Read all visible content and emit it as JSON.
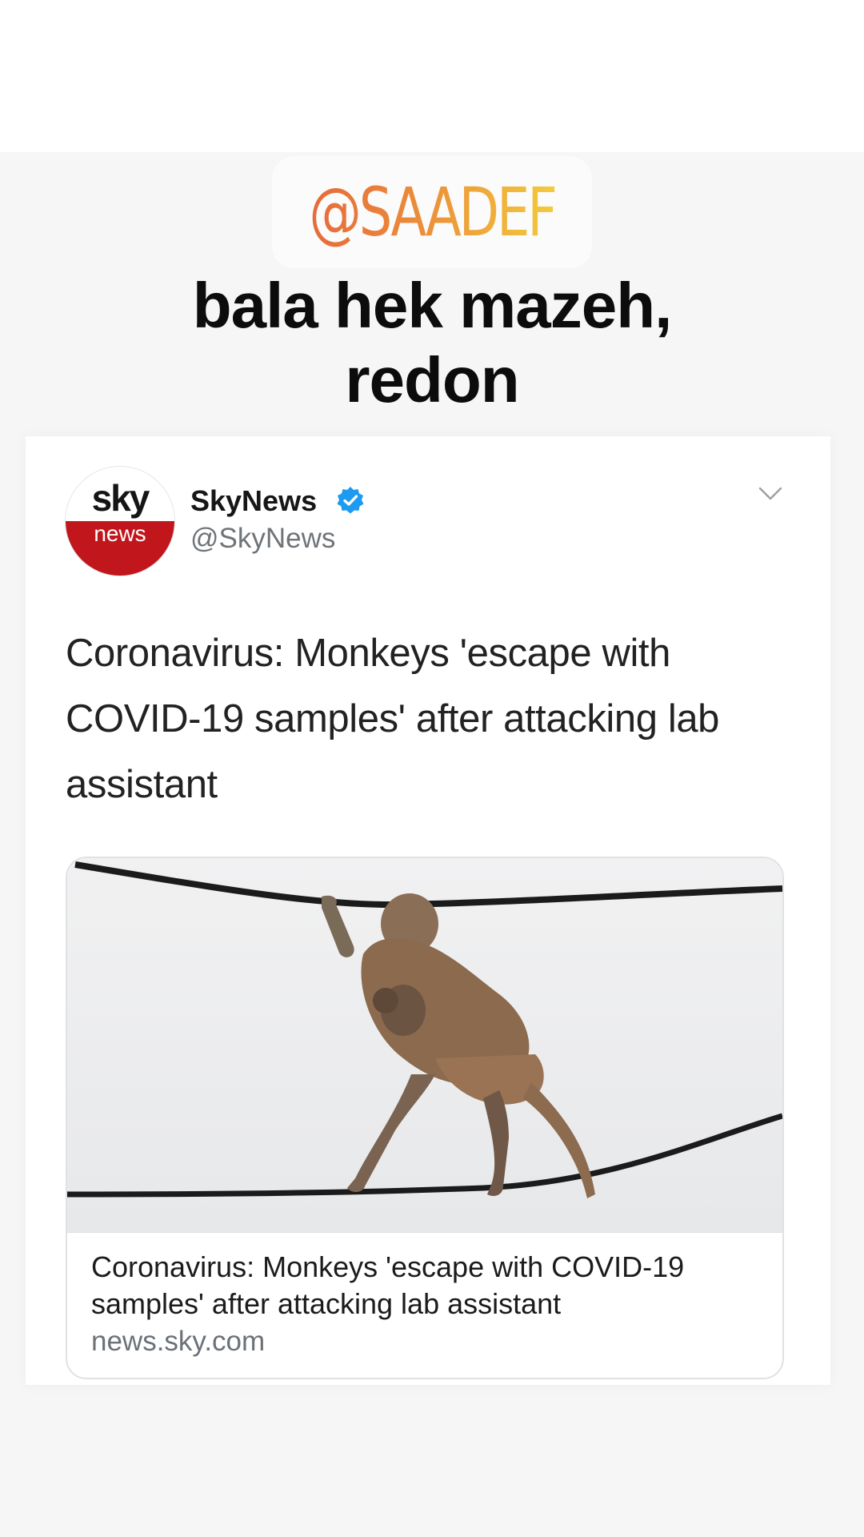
{
  "story": {
    "mention": "@SAADEF",
    "caption": "bala hek mazeh, redon"
  },
  "tweet": {
    "avatar": {
      "top_text": "sky",
      "bottom_text": "news"
    },
    "user_name": "SkyNews",
    "handle": "@SkyNews",
    "text": "Coronavirus: Monkeys 'escape with COVID-19 samples' after attacking lab assistant",
    "link_card": {
      "image_icon": "monkey-on-wire-photo",
      "title": "Coronavirus: Monkeys 'escape with COVID-19 samples' after attacking lab assistant",
      "domain": "news.sky.com"
    }
  },
  "colors": {
    "mention_gradient": [
      "#e66a3c",
      "#f3cb3d"
    ],
    "sky_red": "#c0161c",
    "verified_blue": "#1d9bf0"
  }
}
